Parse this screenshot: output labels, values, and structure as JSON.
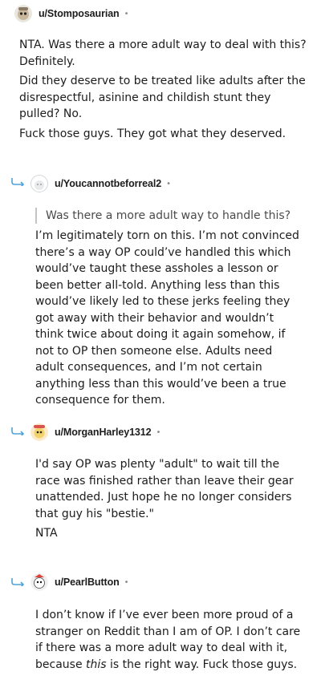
{
  "comments": [
    {
      "username": "u/Stomposaurian",
      "dot": "•",
      "paragraphs": [
        "NTA. Was there a more adult way to deal with this? Definitely.",
        "Did they deserve to be treated like adults after the disrespectful, asinine and childish stunt they pulled? No.",
        "Fuck those guys. They got what they deserved."
      ]
    },
    {
      "username": "u/Youcannotbeforreal2",
      "dot": "•",
      "quote": "Was there a more adult way to handle this?",
      "paragraphs": [
        "I’m legitimately torn on this. I’m not convinced there’s a way OP could’ve handled this which would’ve taught these assholes a lesson or been better all-told. Anything less than this would’ve likely led to these jerks feeling they got away with their behavior and wouldn’t think twice about doing it again somehow, if not to OP then someone else. Adults need adult consequences, and I’m not certain anything less than this would’ve been a true consequence for them."
      ]
    },
    {
      "username": "u/MorganHarley1312",
      "dot": "•",
      "paragraphs": [
        "I'd say OP was plenty \"adult\" to wait till the race was finished rather than leave their gear unattended. Just hope he no longer considers that guy his \"bestie.\"",
        "NTA"
      ]
    },
    {
      "username": "u/PearlButton",
      "dot": "•",
      "paragraph_before_em": "I don’t know if I’ve ever been more proud of a stranger on Reddit than I am of OP. I don’t care if there was a more adult way to deal with it, because ",
      "paragraph_em": "this",
      "paragraph_after_em": " is the right way. Fuck those guys."
    }
  ],
  "colors": {
    "text": "#1c1c1c",
    "meta": "#878a8c",
    "quote_bar": "#c4c4c4",
    "reply_line": "#4fa3d9"
  },
  "icons": {
    "reply": "reply-arrow-icon",
    "avatar": "snoo-avatar-icon"
  }
}
